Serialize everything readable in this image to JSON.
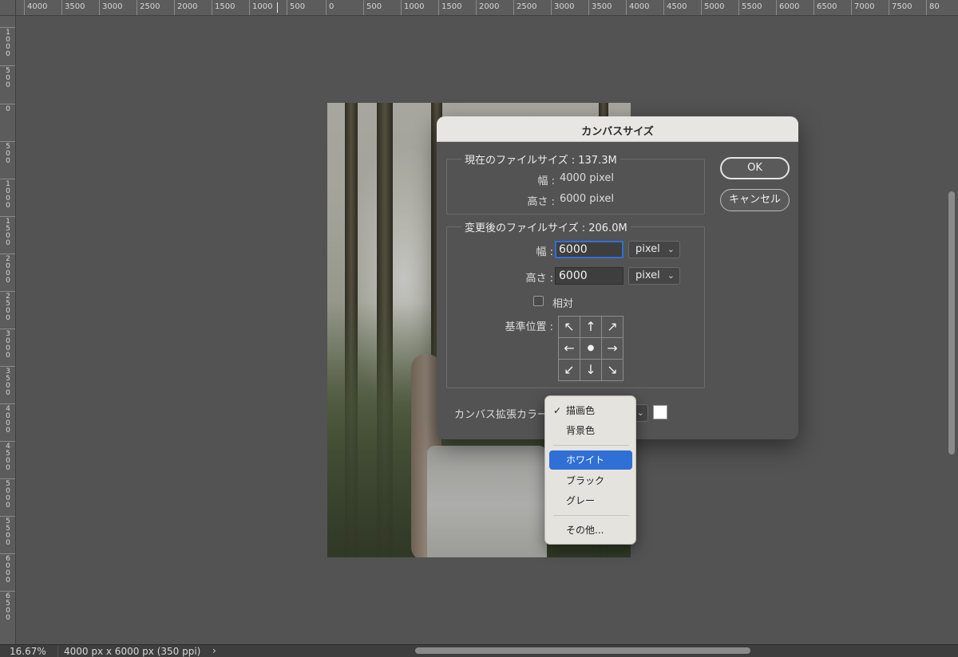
{
  "ruler": {
    "top_labels": [
      "4000",
      "3500",
      "3000",
      "2500",
      "2000",
      "1500",
      "1000",
      "500",
      "0",
      "500",
      "1000",
      "1500",
      "2000",
      "2500",
      "3000",
      "3500",
      "4000",
      "4500",
      "5000",
      "5500",
      "6000",
      "6500",
      "7000",
      "7500",
      "80"
    ],
    "left_labels": [
      "1000",
      "500",
      "0",
      "500",
      "1000",
      "1500",
      "2000",
      "2500",
      "3000",
      "3500",
      "4000",
      "4500",
      "5000",
      "5500",
      "6000",
      "6500"
    ]
  },
  "status": {
    "zoom": "16.67%",
    "doc_info": "4000 px x 6000 px (350 ppi)",
    "arrow": "›"
  },
  "dialog": {
    "title": "カンバスサイズ",
    "current": {
      "label": "現在のファイルサイズ : 137.3M",
      "width_label": "幅 :",
      "width_value": "4000 pixel",
      "height_label": "高さ :",
      "height_value": "6000 pixel"
    },
    "new": {
      "label": "変更後のファイルサイズ : 206.0M",
      "width_label": "幅 :",
      "width_value": "6000",
      "width_unit": "pixel",
      "height_label": "高さ :",
      "height_value": "6000",
      "height_unit": "pixel",
      "relative_label": "相対",
      "anchor_label": "基準位置 :",
      "anchor_arrows": [
        "↖",
        "↑",
        "↗",
        "←",
        "●",
        "→",
        "↙",
        "↓",
        "↘"
      ]
    },
    "extension_color_label": "カンバス拡張カラー :",
    "ok_label": "OK",
    "cancel_label": "キャンセル",
    "swatch_color": "#ffffff"
  },
  "menu": {
    "items": [
      {
        "label": "描画色",
        "checked": true
      },
      {
        "label": "背景色"
      },
      {
        "label": "ホワイト",
        "highlighted": true
      },
      {
        "label": "ブラック"
      },
      {
        "label": "グレー"
      },
      {
        "label": "その他..."
      }
    ],
    "check_glyph": "✓"
  },
  "colors": {
    "accent": "#2f6fd6",
    "dialog_bg": "#535353",
    "menu_bg": "#e4e3de"
  }
}
